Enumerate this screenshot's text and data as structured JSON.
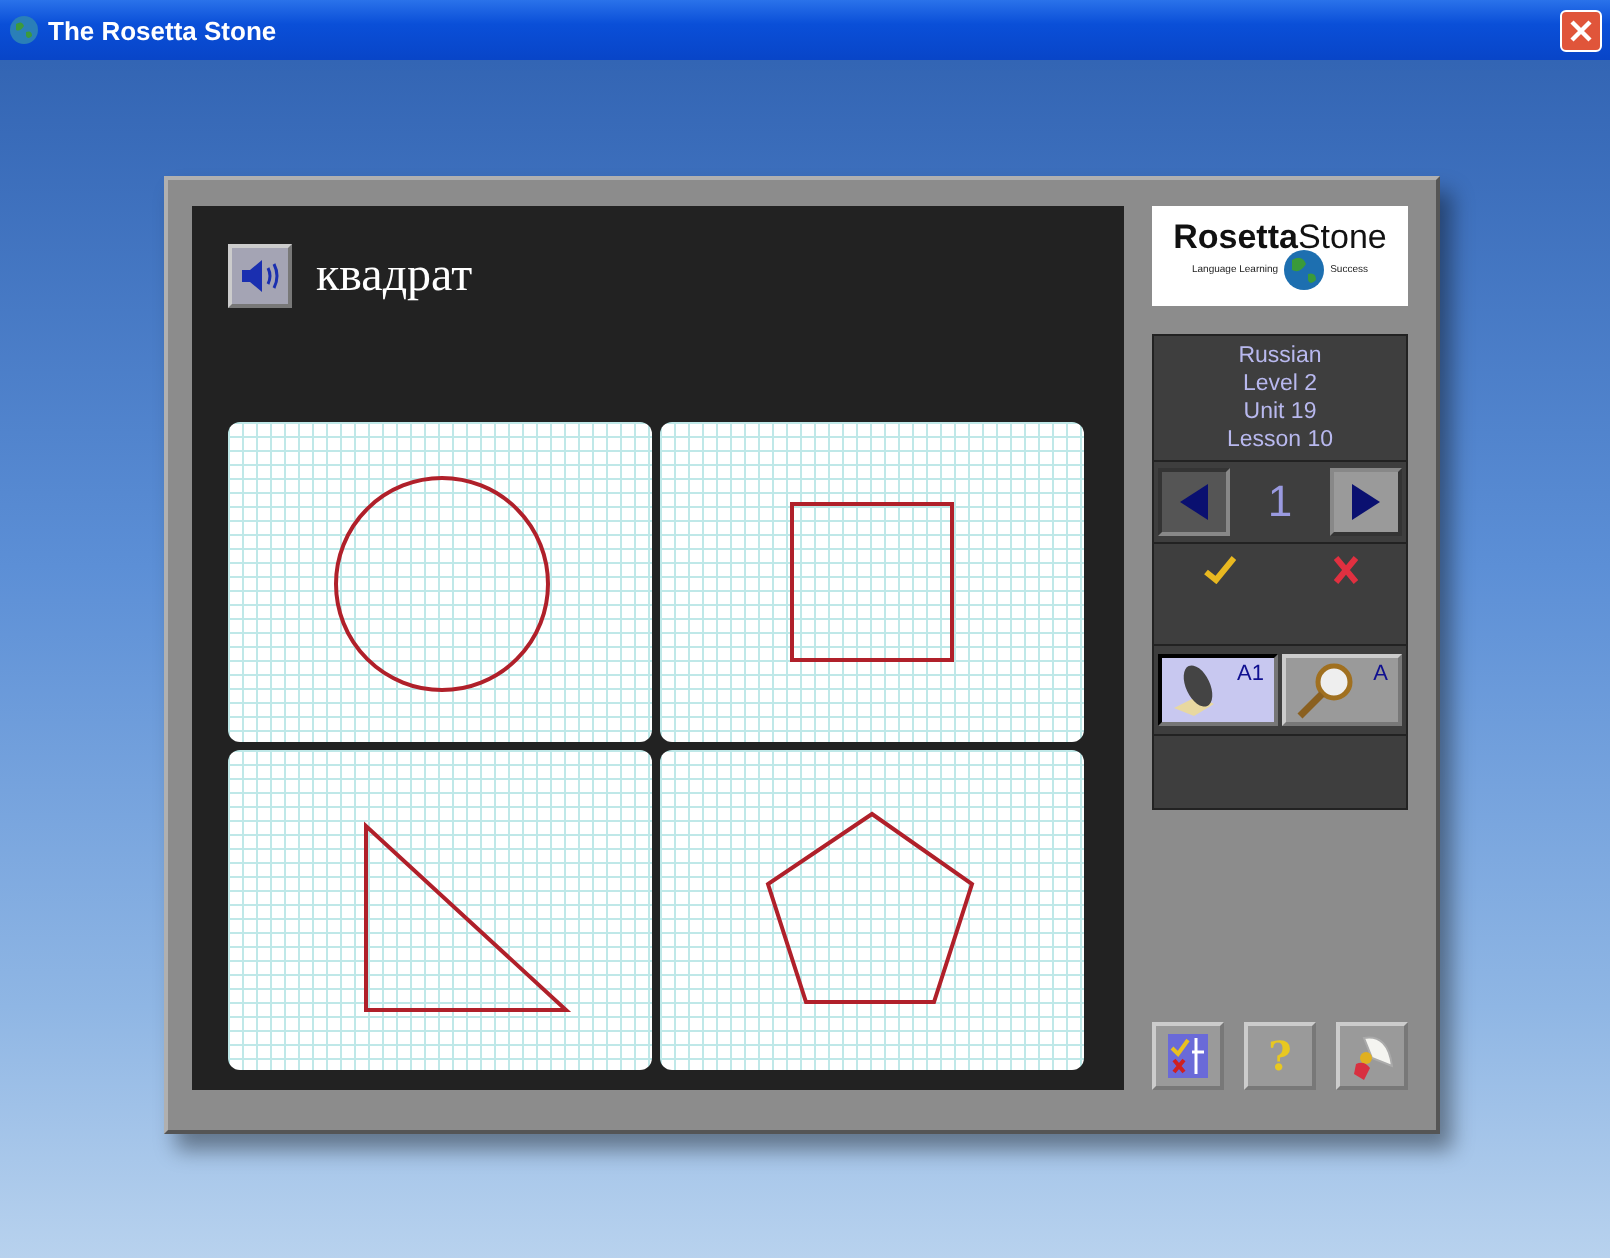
{
  "window": {
    "title": "The Rosetta Stone"
  },
  "prompt": {
    "word": "квадрат"
  },
  "pictures": [
    {
      "kind": "circle"
    },
    {
      "kind": "square"
    },
    {
      "kind": "triangle"
    },
    {
      "kind": "pentagon"
    }
  ],
  "logo": {
    "brand_bold": "Rosetta",
    "brand_light": "Stone",
    "tagline_left": "Language Learning",
    "tagline_right": "Success"
  },
  "course": {
    "lines": [
      "Russian",
      "Level 2",
      "Unit 19",
      "Lesson 10"
    ]
  },
  "navigation": {
    "page": "1"
  },
  "modes": [
    {
      "label": "A1",
      "kind": "listen",
      "selected": true
    },
    {
      "label": "A",
      "kind": "magnify",
      "selected": false
    }
  ],
  "help": {
    "label": "?"
  }
}
